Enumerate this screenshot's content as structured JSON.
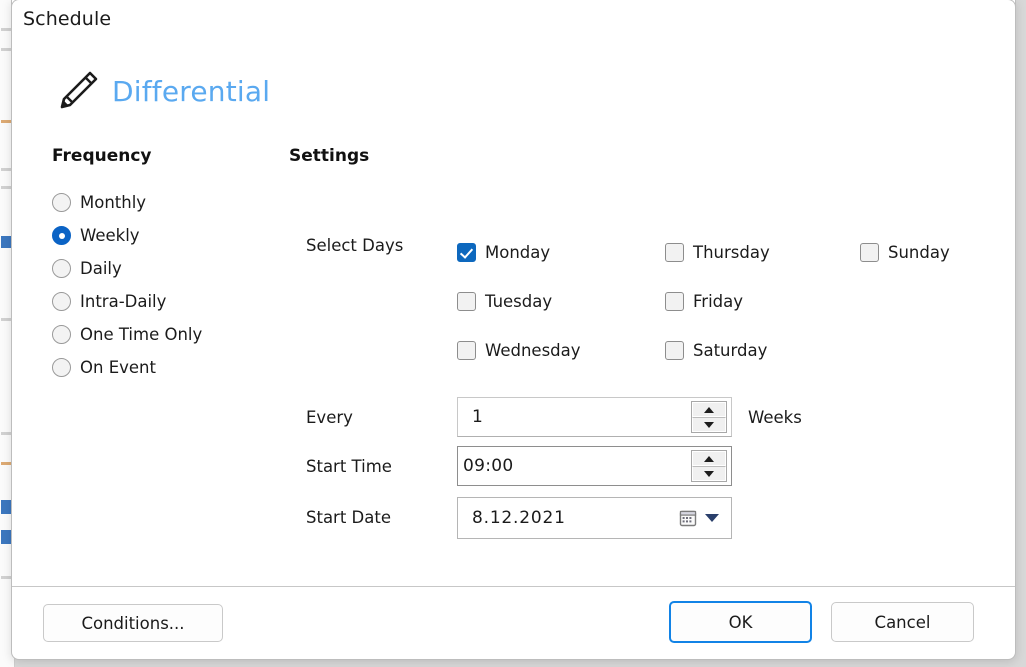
{
  "window": {
    "title": "Schedule"
  },
  "task": {
    "icon": "pencil-icon",
    "name": "Differential"
  },
  "frequency": {
    "section_label": "Frequency",
    "selected": "Weekly",
    "options": [
      {
        "label": "Monthly",
        "checked": false
      },
      {
        "label": "Weekly",
        "checked": true
      },
      {
        "label": "Daily",
        "checked": false
      },
      {
        "label": "Intra-Daily",
        "checked": false
      },
      {
        "label": "One Time Only",
        "checked": false
      },
      {
        "label": "On Event",
        "checked": false
      }
    ]
  },
  "settings": {
    "section_label": "Settings",
    "select_days_label": "Select Days",
    "days": [
      {
        "label": "Monday",
        "checked": true
      },
      {
        "label": "Thursday",
        "checked": false
      },
      {
        "label": "Sunday",
        "checked": false
      },
      {
        "label": "Tuesday",
        "checked": false
      },
      {
        "label": "Friday",
        "checked": false
      },
      {
        "label": "Wednesday",
        "checked": false
      },
      {
        "label": "Saturday",
        "checked": false
      }
    ],
    "every": {
      "label": "Every",
      "value": "1",
      "unit": "Weeks"
    },
    "start_time": {
      "label": "Start Time",
      "value": "09:00"
    },
    "start_date": {
      "label": "Start Date",
      "value": "8.12.2021",
      "icon": "calendar-icon"
    }
  },
  "footer": {
    "conditions_label": "Conditions...",
    "ok_label": "OK",
    "cancel_label": "Cancel"
  },
  "colors": {
    "accent_blue": "#0b63c5",
    "checkbox_blue": "#0d68be",
    "task_name_blue": "#5aa9f0",
    "focus_border": "#1283e6"
  }
}
